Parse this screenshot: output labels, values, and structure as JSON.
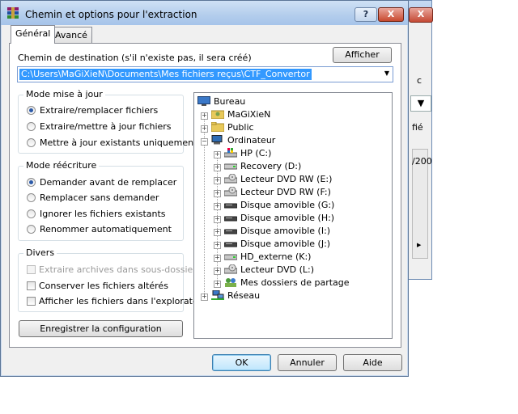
{
  "window": {
    "title": "Chemin et options pour l'extraction",
    "help_glyph": "?",
    "close_glyph": "X"
  },
  "background_window": {
    "close_glyph": "X",
    "btn1": "c",
    "btn2": "",
    "cell1": "fié",
    "cell2": "/200"
  },
  "tabs": [
    {
      "label": "Général",
      "active": true
    },
    {
      "label": "Avancé",
      "active": false
    }
  ],
  "destination": {
    "label": "Chemin de destination (s'il n'existe pas, il sera créé)",
    "show_button": "Afficher",
    "path": "C:\\Users\\MaGiXieN\\Documents\\Mes fichiers reçus\\CTF_Convertor"
  },
  "update_mode": {
    "title": "Mode mise à jour",
    "options": [
      {
        "label": "Extraire/remplacer fichiers",
        "selected": true
      },
      {
        "label": "Extraire/mettre à jour fichiers",
        "selected": false
      },
      {
        "label": "Mettre à jour existants uniquement",
        "selected": false
      }
    ]
  },
  "overwrite_mode": {
    "title": "Mode réécriture",
    "options": [
      {
        "label": "Demander avant de remplacer",
        "selected": true
      },
      {
        "label": "Remplacer sans demander",
        "selected": false
      },
      {
        "label": "Ignorer les fichiers existants",
        "selected": false
      },
      {
        "label": "Renommer automatiquement",
        "selected": false
      }
    ]
  },
  "misc": {
    "title": "Divers",
    "options": [
      {
        "label": "Extraire archives dans sous-dossiers",
        "checked": false,
        "disabled": true
      },
      {
        "label": "Conserver les fichiers altérés",
        "checked": false,
        "disabled": false
      },
      {
        "label": "Afficher les fichiers dans l'explorateur",
        "checked": false,
        "disabled": false
      }
    ]
  },
  "save_config_button": "Enregistrer la configuration",
  "tree": [
    {
      "label": "Bureau",
      "icon": "desktop-icon"
    },
    {
      "label": "MaGiXieN",
      "icon": "user-folder-icon"
    },
    {
      "label": "Public",
      "icon": "folder-icon"
    },
    {
      "label": "Ordinateur",
      "icon": "computer-icon"
    },
    {
      "label": "HP (C:)",
      "icon": "system-drive-icon"
    },
    {
      "label": "Recovery (D:)",
      "icon": "hard-drive-icon"
    },
    {
      "label": "Lecteur DVD RW (E:)",
      "icon": "dvd-drive-icon"
    },
    {
      "label": "Lecteur DVD RW (F:)",
      "icon": "dvd-drive-icon"
    },
    {
      "label": "Disque amovible (G:)",
      "icon": "removable-drive-icon"
    },
    {
      "label": "Disque amovible (H:)",
      "icon": "removable-drive-icon"
    },
    {
      "label": "Disque amovible (I:)",
      "icon": "removable-drive-icon"
    },
    {
      "label": "Disque amovible (J:)",
      "icon": "removable-drive-icon"
    },
    {
      "label": "HD_externe (K:)",
      "icon": "hard-drive-icon"
    },
    {
      "label": "Lecteur DVD (L:)",
      "icon": "dvd-drive-icon"
    },
    {
      "label": "Mes dossiers de partage",
      "icon": "shared-folder-icon"
    },
    {
      "label": "Réseau",
      "icon": "network-icon"
    }
  ],
  "buttons": {
    "ok": "OK",
    "cancel": "Annuler",
    "help": "Aide"
  },
  "colors": {
    "selection": "#3399ff",
    "title_gradient": "#b3cdec",
    "close_red": "#c8492f"
  }
}
